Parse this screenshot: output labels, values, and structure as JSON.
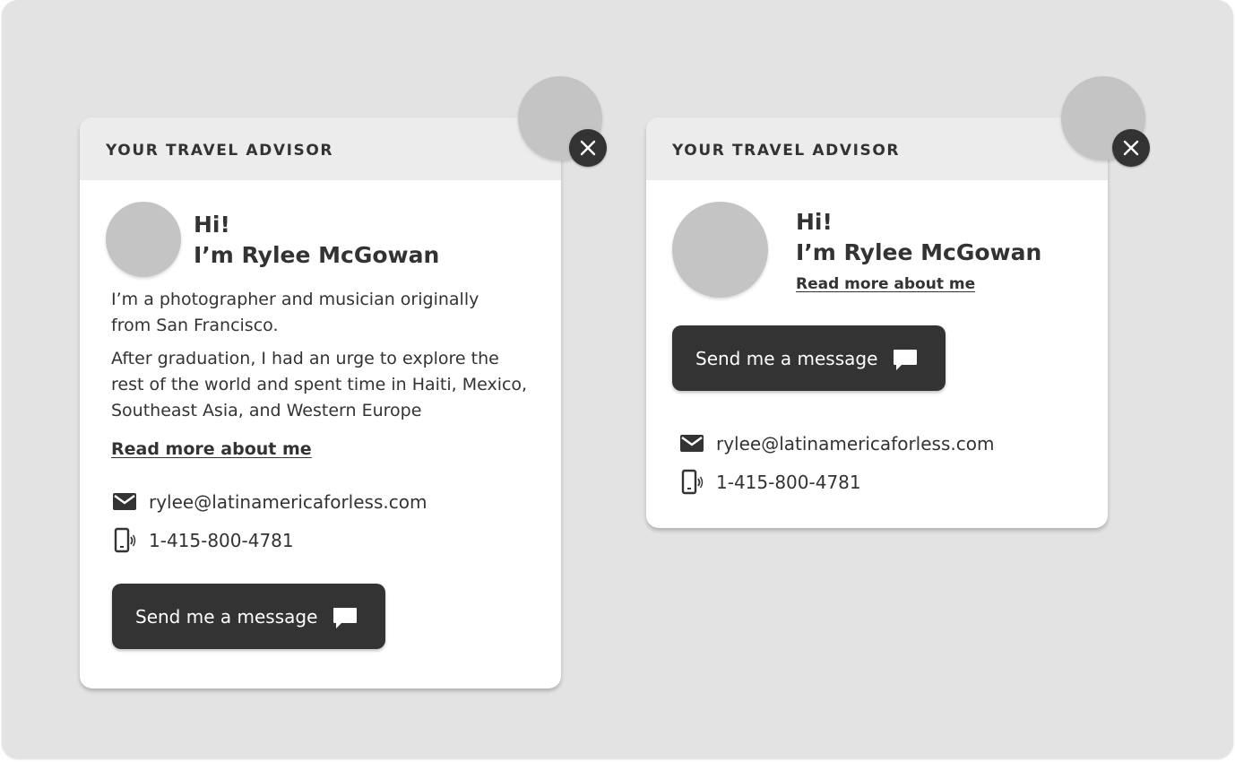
{
  "colors": {
    "background": "#e3e3e3",
    "card": "#ffffff",
    "header": "#ececec",
    "placeholder": "#c4c4c4",
    "dark": "#333333"
  },
  "cards": [
    {
      "header_title": "YOUR TRAVEL ADVISOR",
      "greeting_line1": "Hi!",
      "greeting_line2": "I’m Rylee McGowan",
      "bio_para1": "I’m a photographer and musician originally from San Francisco.",
      "bio_para2": "After graduation, I had an urge to explore the rest of the world and spent time in Haiti, Mexico, Southeast Asia, and Western Europe",
      "read_more": "Read more about me",
      "email": "rylee@latinamericaforless.com",
      "phone": "1-415-800-4781",
      "message_button": "Send me a message",
      "icons": {
        "close": "close-icon",
        "email": "envelope-icon",
        "phone": "mobile-phone-icon",
        "message": "chat-bubble-icon"
      }
    },
    {
      "header_title": "YOUR TRAVEL ADVISOR",
      "greeting_line1": "Hi!",
      "greeting_line2": "I’m Rylee McGowan",
      "read_more": "Read more about me",
      "message_button": "Send me a message",
      "email": "rylee@latinamericaforless.com",
      "phone": "1-415-800-4781",
      "icons": {
        "close": "close-icon",
        "email": "envelope-icon",
        "phone": "mobile-phone-icon",
        "message": "chat-bubble-icon"
      }
    }
  ]
}
